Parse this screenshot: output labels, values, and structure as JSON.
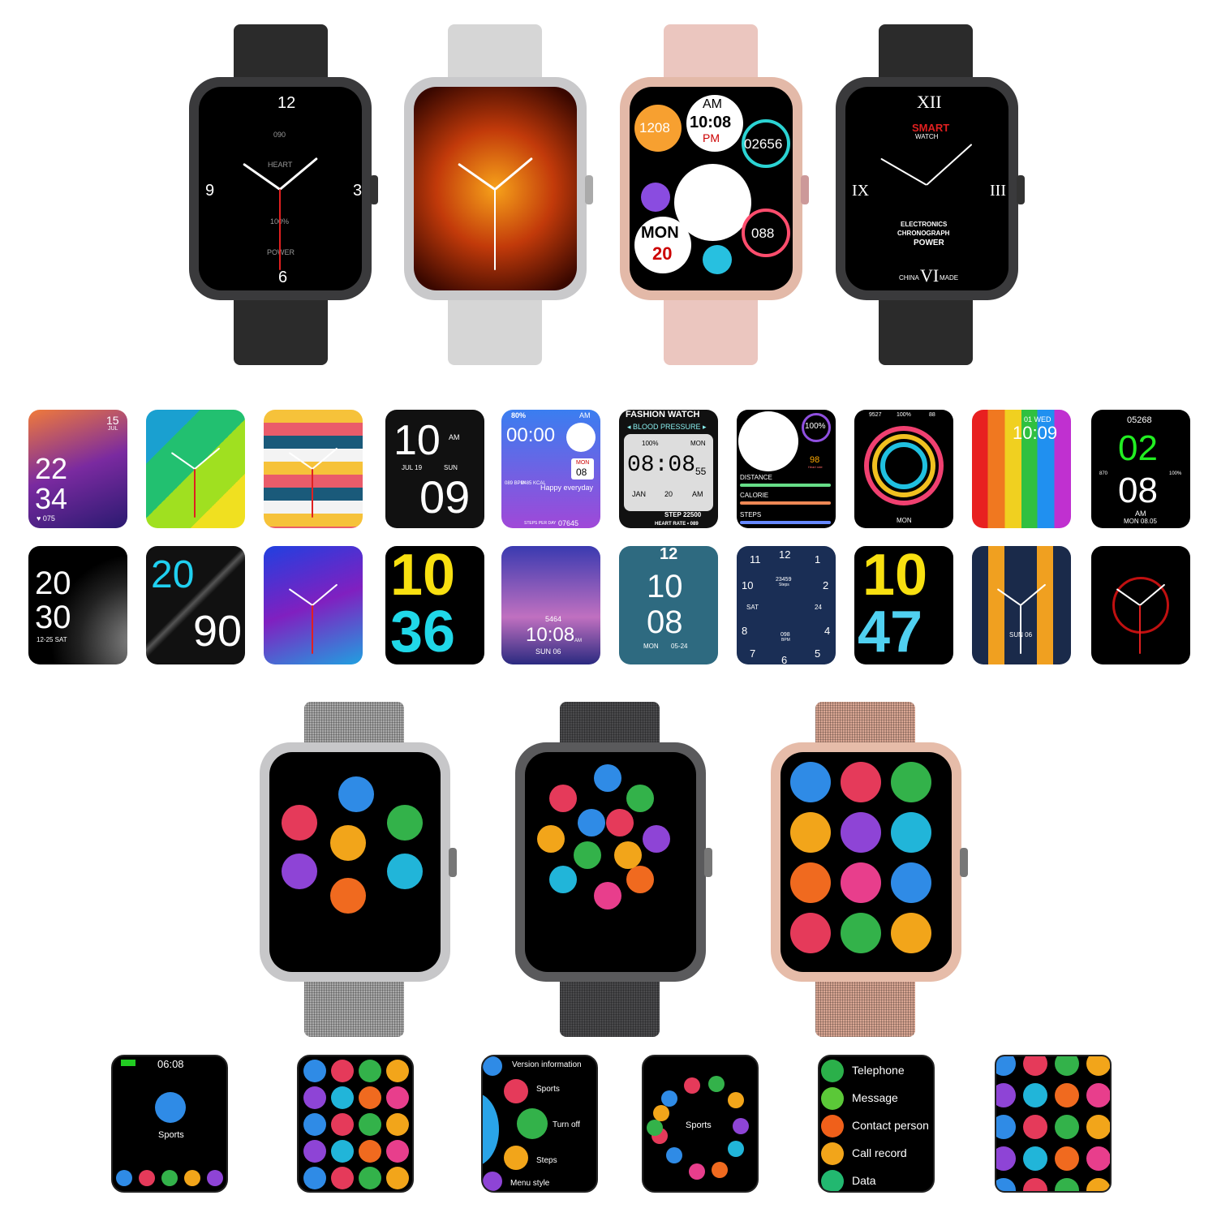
{
  "top_watches": [
    {
      "band": "#2b2b2b",
      "case": "#3a3a3c",
      "dial": {
        "n12": "12",
        "n3": "3",
        "n6": "6",
        "n9": "9",
        "sub1": "090",
        "sub1_label": "HEART",
        "sub2": "100%",
        "sub2_label": "POWER"
      }
    },
    {
      "band": "#d6d6d6",
      "case": "#c9c9cb"
    },
    {
      "band": "#ebc6bf",
      "case": "#e3b9a8",
      "dial": {
        "am": "AM",
        "time": "10:08",
        "pm": "PM",
        "steps": "1208",
        "count": "02656",
        "hr": "088",
        "day": "MON",
        "date": "20"
      }
    },
    {
      "band": "#2b2b2b",
      "case": "#3a3a3c",
      "dial": {
        "xii": "XII",
        "iii": "III",
        "vi": "VI",
        "ix": "IX",
        "brand": "SMART",
        "brand2": "WATCH",
        "line1": "ELECTRONICS",
        "line2": "CHRONOGRAPH",
        "line3": "POWER",
        "left": "CHINA",
        "right": "MADE"
      }
    }
  ],
  "faces_row1": [
    {
      "day": "15",
      "month": "JUL",
      "hour": "22",
      "min": "34",
      "hr": "♥ 075"
    },
    {},
    {},
    {
      "hour": "10",
      "ampm": "AM",
      "date": "JUL 19",
      "day": "SUN",
      "min": "09"
    },
    {
      "battery": "80%",
      "ampm": "AM",
      "time": "00:00",
      "day": "MON",
      "date": "08",
      "bpm": "089 BPM",
      "kcal": "0485 KCAL",
      "motto": "Happy everyday",
      "steps_label": "STEPS PER DAY",
      "steps": "07645"
    },
    {
      "title": "FASHION WATCH",
      "mode": "◂ BLOOD PRESSURE ▸",
      "battery": "100%",
      "day": "MON",
      "time": "08:08",
      "sec": "55",
      "month": "JAN",
      "date": "20",
      "ampm": "AM",
      "steps": "STEP 22500",
      "hr": "HEART RATE • 089"
    },
    {
      "battery": "100%",
      "hr": "98",
      "hr_label": "Heart rate",
      "l1": "DISTANCE",
      "l2": "CALORIE",
      "l3": "STEPS"
    },
    {
      "a": "9527",
      "b": "100%",
      "c": "88",
      "day": "MON"
    },
    {
      "date": "01 WED",
      "time": "10:09"
    },
    {
      "steps": "05268",
      "hour": "02",
      "min": "08",
      "ampm": "AM",
      "date": "MON 08.05",
      "left": "870",
      "right": "100%"
    }
  ],
  "faces_row2": [
    {
      "hour": "20",
      "min": "30",
      "date": "12-25 SAT"
    },
    {
      "hour": "20",
      "min": "90"
    },
    {},
    {
      "hour": "10",
      "min": "36"
    },
    {
      "steps": "5464",
      "time": "10:08",
      "ampm": "AM",
      "date": "SUN 06"
    },
    {
      "top": "12",
      "hour": "10",
      "min": "08",
      "day": "MON",
      "date": "05-24"
    },
    {
      "n12": "12",
      "n11": "11",
      "n1": "1",
      "n10": "10",
      "n2": "2",
      "n8": "8",
      "n4": "4",
      "n7": "7",
      "n6": "6",
      "n5": "5",
      "steps": "23459",
      "steps_label": "Steps",
      "day": "SAT",
      "date": "24",
      "bpm": "098",
      "bpm_label": "BPM"
    },
    {
      "hour": "10",
      "min": "47"
    },
    {
      "date": "SUN 06"
    },
    {}
  ],
  "bottom_watches": [
    {
      "band": "#a9a9a9",
      "case": "#c7c7c9"
    },
    {
      "band": "#4a4a4c",
      "case": "#5a5a5c"
    },
    {
      "band": "#d9a693",
      "case": "#e6bca9"
    }
  ],
  "screens": {
    "s1": {
      "time": "06:08",
      "label": "Sports"
    },
    "s3": {
      "items": [
        "Version information",
        "Sports",
        "Turn off",
        "Steps",
        "Menu style"
      ]
    },
    "s4": {
      "label": "Sports"
    },
    "s5": {
      "items": [
        "Telephone",
        "Message",
        "Contact person",
        "Call record",
        "Data"
      ]
    }
  },
  "icon_colors": [
    "#2f8be6",
    "#e53a5a",
    "#33b24a",
    "#f2a51a",
    "#8e44d6",
    "#21b5d9",
    "#f06a1f",
    "#e83e8c"
  ]
}
